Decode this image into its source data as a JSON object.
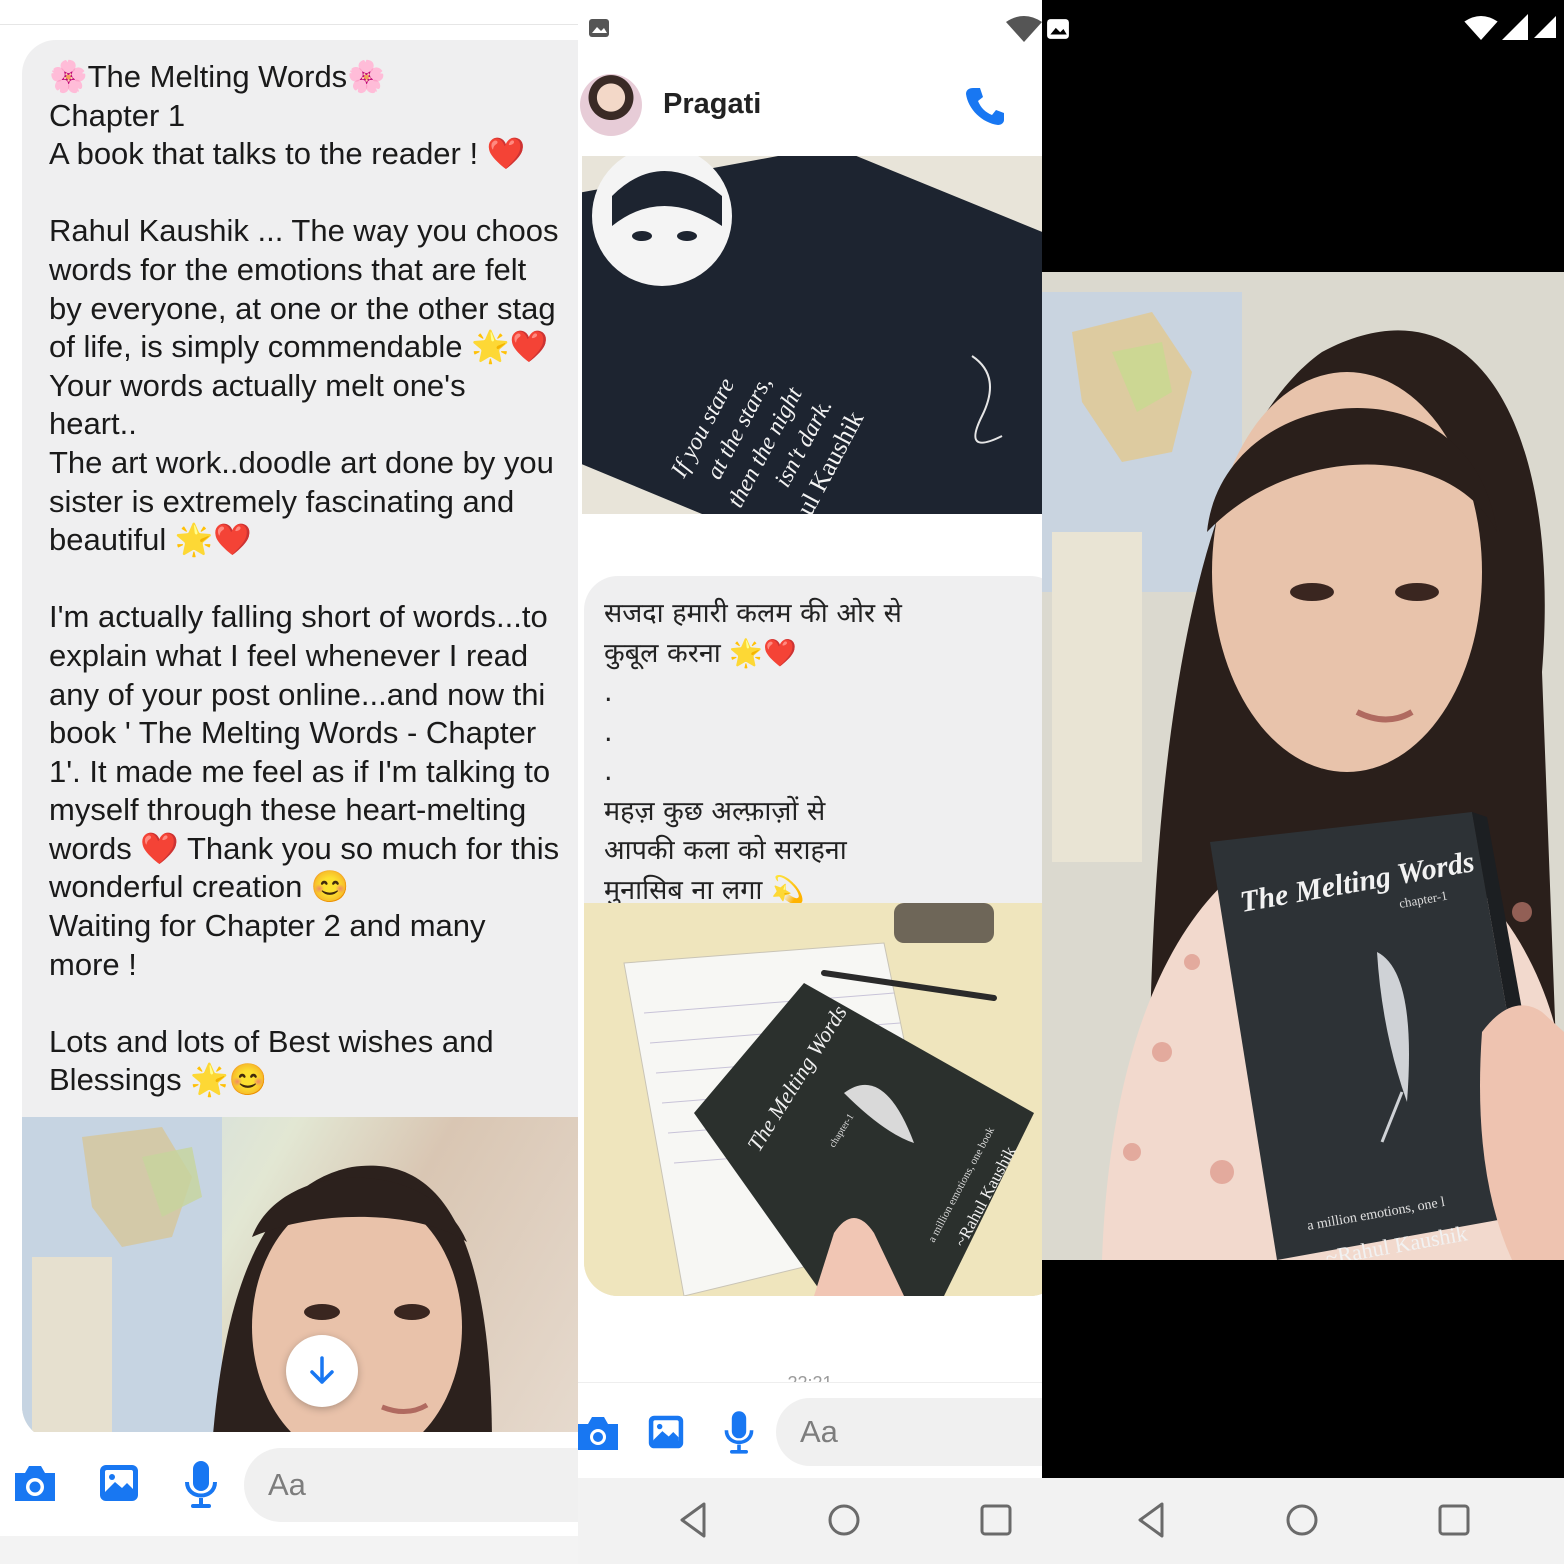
{
  "left_chat": {
    "message": "🌸The Melting Words🌸\nChapter 1\nA book that talks to the reader ! ❤️\n\nRahul Kaushik ... The way you choos\nwords for the emotions that are felt\nby everyone, at one or the other stag\nof life, is simply commendable 🌟❤️\nYour words actually melt one's\nheart..\nThe art work..doodle art done by you\nsister is extremely fascinating and\nbeautiful 🌟❤️\n\nI'm actually falling short of words...to\nexplain what I feel whenever I read\nany of your post online...and now thi\nbook ' The Melting Words - Chapter\n1'. It made me feel as if I'm talking to\nmyself through these heart-melting\nwords ❤️ Thank you so much for this\nwonderful creation 😊\nWaiting for Chapter 2 and many\nmore !\n\nLots and lots of Best wishes and\nBlessings 🌟😊",
    "composer_placeholder": "Aa"
  },
  "middle_chat": {
    "contact_name": "Pragati",
    "bookmark_quote": "If you stare\nat the stars,\nthen the night\nisn't dark.",
    "bookmark_author": "~Rahul Kaushik",
    "message": "सजदा हमारी कलम की ओर से\nकुबूल करना 🌟❤️\n.\n.\n.\nमहज़ कुछ अल्फ़ाज़ों से\nआपकी कला को सराहना\nमुनासिब ना लगा 💫",
    "book_title": "The Melting Words",
    "book_chapter": "chapter-1",
    "book_tagline": "a million emotions, one book",
    "book_author": "~Rahul Kaushik",
    "composer_placeholder": "Aa"
  },
  "right_photo": {
    "book_title": "The Melting Words",
    "book_chapter": "chapter-1",
    "book_tagline": "a million emotions, one l",
    "book_author": "~Rahul Kaushik"
  },
  "colors": {
    "accent": "#1877f2",
    "bubble": "#efeff0",
    "heart": "#e0242b"
  }
}
